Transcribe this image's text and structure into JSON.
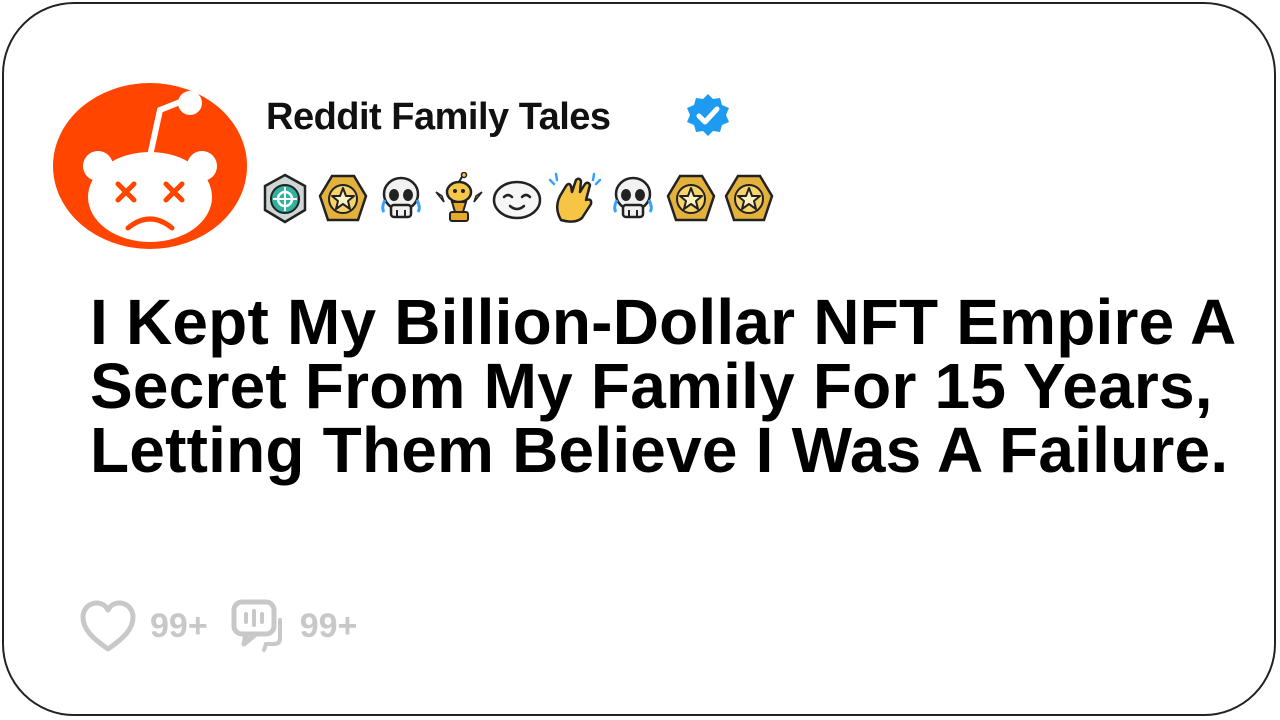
{
  "post": {
    "channel_name": "Reddit Family Tales",
    "verified": true,
    "avatar_icon": "reddit-snoo-sad-icon",
    "title": "I Kept My Billion-Dollar NFT Empire A Secret From My Family For 15 Years, Letting Them Believe I Was A Failure."
  },
  "awards": [
    {
      "icon": "helpful-award-icon"
    },
    {
      "icon": "gold-star-award-icon"
    },
    {
      "icon": "crying-skull-award-icon"
    },
    {
      "icon": "snoo-trophy-award-icon"
    },
    {
      "icon": "smiling-face-award-icon"
    },
    {
      "icon": "clapping-hands-award-icon"
    },
    {
      "icon": "crying-skull-award-icon"
    },
    {
      "icon": "gold-star-award-icon"
    },
    {
      "icon": "gold-star-award-icon"
    }
  ],
  "stats": {
    "likes": "99+",
    "comments": "99+"
  },
  "colors": {
    "brand_orange": "#ff4500",
    "verified_blue": "#1d9bf0",
    "muted_gray": "#c8c8c8"
  }
}
